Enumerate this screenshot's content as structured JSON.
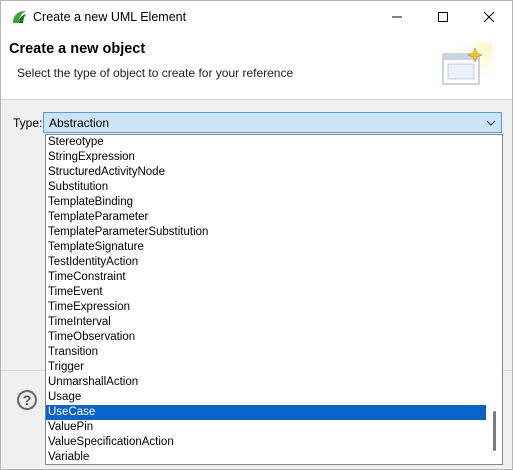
{
  "window": {
    "title": "Create a new UML Element"
  },
  "header": {
    "title": "Create a new object",
    "description": "Select the type of object to create for your reference"
  },
  "type_field": {
    "label": "Type:",
    "selected_value": "Abstraction"
  },
  "dropdown": {
    "items": [
      "Stereotype",
      "StringExpression",
      "StructuredActivityNode",
      "Substitution",
      "TemplateBinding",
      "TemplateParameter",
      "TemplateParameterSubstitution",
      "TemplateSignature",
      "TestIdentityAction",
      "TimeConstraint",
      "TimeEvent",
      "TimeExpression",
      "TimeInterval",
      "TimeObservation",
      "Transition",
      "Trigger",
      "UnmarshallAction",
      "Usage",
      "UseCase",
      "ValuePin",
      "ValueSpecificationAction",
      "Variable"
    ],
    "highlighted_item": "UseCase"
  },
  "help": {
    "glyph": "?"
  },
  "icons": {
    "app": "eclipse-sirius-icon",
    "minimize": "minimize-icon",
    "maximize": "maximize-icon",
    "close": "close-icon",
    "wizard": "wizard-banner-icon",
    "combo_arrow": "chevron-down-icon",
    "help": "help-icon"
  },
  "colors": {
    "selection": "#0a64c8",
    "combo_focus": "#cce4f7",
    "combo_border": "#5a9ad8",
    "window_bg": "#f0f0f0"
  }
}
